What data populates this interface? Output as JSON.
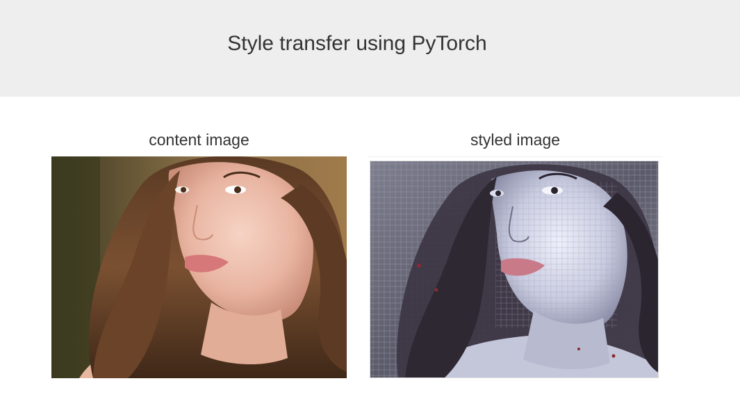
{
  "header": {
    "title": "Style transfer using PyTorch"
  },
  "panels": {
    "content": {
      "caption": "content image",
      "image": "portrait-photo"
    },
    "styled": {
      "caption": "styled image",
      "image": "stylized-portrait"
    }
  },
  "colors": {
    "header_bg": "#eeeeee",
    "text": "#333333",
    "page_bg": "#ffffff"
  }
}
